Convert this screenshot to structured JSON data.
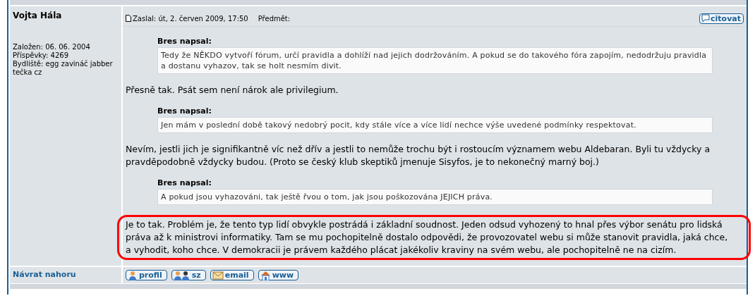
{
  "author": {
    "name": "Vojta Hála",
    "details": [
      "Založen: 06. 06. 2004",
      "Příspěvky: 4269",
      "Bydliště: egg zavináč jabber tečka cz"
    ]
  },
  "post_header": {
    "posted": "Zaslal: út, 2. červen 2009, 17:50",
    "subject_label": "Předmět:",
    "quote_button": "citovat"
  },
  "body": [
    {
      "kind": "quote",
      "author": "Bres napsal:",
      "text": "Tedy že NĚKDO vytvoří fórum, určí pravidla a dohlíží nad jejich dodržováním. A pokud se do takového fóra zapojím, nedodržuju pravidla a dostanu vyhazov, tak se holt nesmím divit."
    },
    {
      "kind": "text",
      "highlighted": false,
      "text": "Přesně tak. Psát sem není nárok ale privilegium."
    },
    {
      "kind": "quote",
      "author": "Bres napsal:",
      "text": "Jen mám v poslední době takový nedobrý pocit, kdy stále více a více lidí nechce výše uvedené podmínky respektovat."
    },
    {
      "kind": "text",
      "highlighted": false,
      "text": "Nevím, jestli jich je signifikantně víc než dřív a jestli to nemůže trochu být i rostoucím významem webu Aldebaran. Byli tu vždycky a pravděpodobně vždycky budou. (Proto se český klub skeptiků jmenuje Sisyfos, je to nekonečný marný boj.)"
    },
    {
      "kind": "quote",
      "author": "Bres napsal:",
      "text": "A pokud jsou vyhazováni, tak ještě řvou o tom, jak jsou poškozována JEJICH práva."
    },
    {
      "kind": "text",
      "highlighted": true,
      "text": "Je to tak. Problém je, že tento typ lidí obvykle postrádá i základní soudnost. Jeden odsud vyhozený to hnal přes výbor senátu pro lidská práva až k ministrovi informatiky. Tam se mu pochopitelně dostalo odpovědi, že provozovatel webu si může stanovit pravidla, jaká chce, a vyhodit, koho chce. V demokracii je právem každého plácat jakékoliv kraviny na svém webu, ale pochopitelně ne na cizím."
    }
  ],
  "footer": {
    "back_to_top": "Návrat nahoru",
    "buttons": [
      {
        "kind": "profile",
        "label": "profil"
      },
      {
        "kind": "pm",
        "label": "sz"
      },
      {
        "kind": "email",
        "label": "email"
      },
      {
        "kind": "www",
        "label": "www"
      }
    ]
  }
}
